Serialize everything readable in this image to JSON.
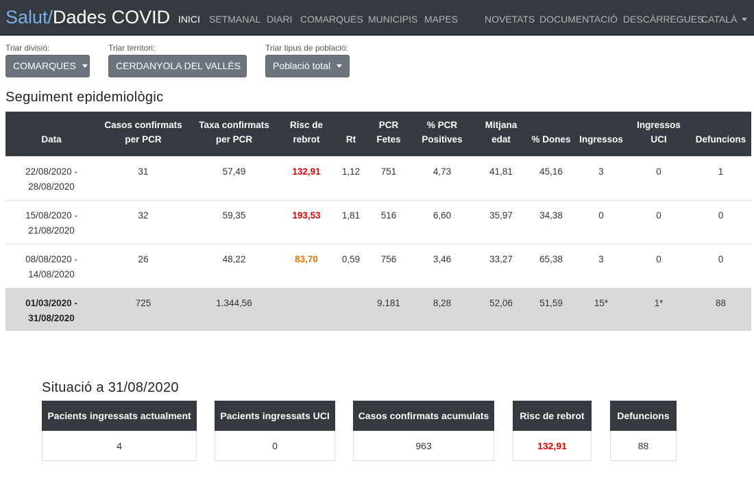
{
  "brand": {
    "part1": "Salut/",
    "part2": "Dades COVID"
  },
  "nav": {
    "left": [
      "INICI",
      "SETMANAL",
      "DIARI",
      "COMARQUES",
      "MUNICIPIS",
      "MAPES"
    ],
    "right": [
      "NOVETATS",
      "DOCUMENTACIÓ",
      "DESCÀRREGUES",
      "CATALÀ"
    ],
    "active": "INICI"
  },
  "filters": {
    "division": {
      "label": "Triar divisió:",
      "value": "COMARQUES"
    },
    "territory": {
      "label": "Triar territori:",
      "value": "CERDANYOLA DEL VALLÈS"
    },
    "population": {
      "label": "Triar tipus de població:",
      "value": "Població total"
    }
  },
  "section_title": "Seguiment epidemiològic",
  "table": {
    "headers": [
      "Data",
      "Casos confirmats per PCR",
      "Taxa confirmats per PCR",
      "Risc de rebrot",
      "Rt",
      "PCR Fetes",
      "% PCR Positives",
      "Mitjana edat",
      "% Dones",
      "Ingressos",
      "Ingressos UCI",
      "Defuncions"
    ],
    "rows": [
      {
        "date": "22/08/2020 - 28/08/2020",
        "casos": "31",
        "taxa": "57,49",
        "risc": "132,91",
        "risc_color": "#e00000",
        "rt": "1,12",
        "pcr": "751",
        "pct_pos": "4,73",
        "edat": "41,81",
        "dones": "45,16",
        "ingressos": "3",
        "uci": "0",
        "defuncions": "1"
      },
      {
        "date": "15/08/2020 - 21/08/2020",
        "casos": "32",
        "taxa": "59,35",
        "risc": "193,53",
        "risc_color": "#e00000",
        "rt": "1,81",
        "pcr": "516",
        "pct_pos": "6,60",
        "edat": "35,97",
        "dones": "34,38",
        "ingressos": "0",
        "uci": "0",
        "defuncions": "0"
      },
      {
        "date": "08/08/2020 - 14/08/2020",
        "casos": "26",
        "taxa": "48,22",
        "risc": "83,70",
        "risc_color": "#f07000",
        "rt": "0,59",
        "pcr": "756",
        "pct_pos": "3,46",
        "edat": "33,27",
        "dones": "65,38",
        "ingressos": "3",
        "uci": "0",
        "defuncions": "0"
      }
    ],
    "total": {
      "date": "01/03/2020 - 31/08/2020",
      "casos": "725",
      "taxa": "1.344,56",
      "risc": "",
      "rt": "",
      "pcr": "9.181",
      "pct_pos": "8,28",
      "edat": "52,06",
      "dones": "51,59",
      "ingressos": "15*",
      "uci": "1*",
      "defuncions": "88"
    }
  },
  "situation": {
    "title": "Situació a 31/08/2020",
    "cards": [
      {
        "label": "Pacients ingressats actualment",
        "value": "4"
      },
      {
        "label": "Pacients ingressats UCI",
        "value": "0"
      },
      {
        "label": "Casos confirmats acumulats",
        "value": "963"
      },
      {
        "label": "Risc de rebrot",
        "value": "132,91",
        "color": "#e00000"
      },
      {
        "label": "Defuncions",
        "value": "88"
      }
    ]
  }
}
